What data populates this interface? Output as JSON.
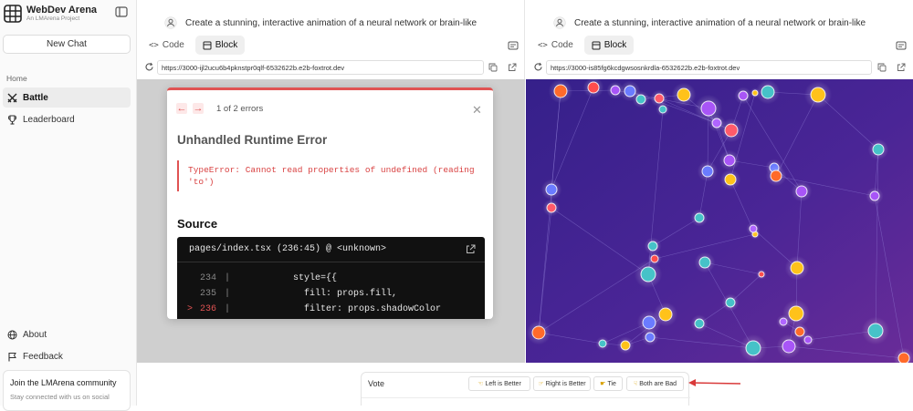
{
  "sidebar": {
    "title": "WebDev Arena",
    "subtitle": "An LMArena Project",
    "new_chat": "New Chat",
    "home": "Home",
    "items": [
      {
        "label": "Battle",
        "icon": "swords-icon",
        "active": true
      },
      {
        "label": "Leaderboard",
        "icon": "trophy-icon",
        "active": false
      }
    ],
    "bottom_items": [
      {
        "label": "About",
        "icon": "globe-icon"
      },
      {
        "label": "Feedback",
        "icon": "flag-icon"
      }
    ],
    "community": {
      "title": "Join the LMArena community",
      "subtitle": "Stay connected with us on social"
    }
  },
  "panels": {
    "left": {
      "prompt": "Create a stunning, interactive animation of a neural network or brain-like",
      "tabs": [
        "Code",
        "Block"
      ],
      "active_tab": "Block",
      "url": "https://3000-ijl2ucu6b4pknstpr0qlf-6532622b.e2b-foxtrot.dev",
      "error": {
        "count": "1 of 2 errors",
        "title": "Unhandled Runtime Error",
        "message": "TypeError: Cannot read properties of undefined (reading 'to')",
        "source_label": "Source",
        "file": "pages/index.tsx (236:45) @ <unknown>",
        "lines": [
          {
            "marker": "",
            "num": "234",
            "code": "          style={{"
          },
          {
            "marker": "",
            "num": "235",
            "code": "            fill: props.fill,"
          },
          {
            "marker": ">",
            "num": "236",
            "code": "            filter: props.shadowColor"
          }
        ]
      }
    },
    "right": {
      "prompt": "Create a stunning, interactive animation of a neural network or brain-like",
      "tabs": [
        "Code",
        "Block"
      ],
      "active_tab": "Block",
      "url": "https://3000-is85fg6kcdgwsosnkrdla-6532622b.e2b-foxtrot.dev"
    }
  },
  "vote": {
    "label": "Vote",
    "buttons": [
      "Left is Better",
      "Right is Better",
      "Tie",
      "Both are Bad"
    ]
  },
  "colors": {
    "accent_error": "#e05353",
    "graph_bg_start": "#3b1d8c",
    "graph_bg_end": "#5a2a9a",
    "annotation_arrow": "#d93a3a"
  }
}
